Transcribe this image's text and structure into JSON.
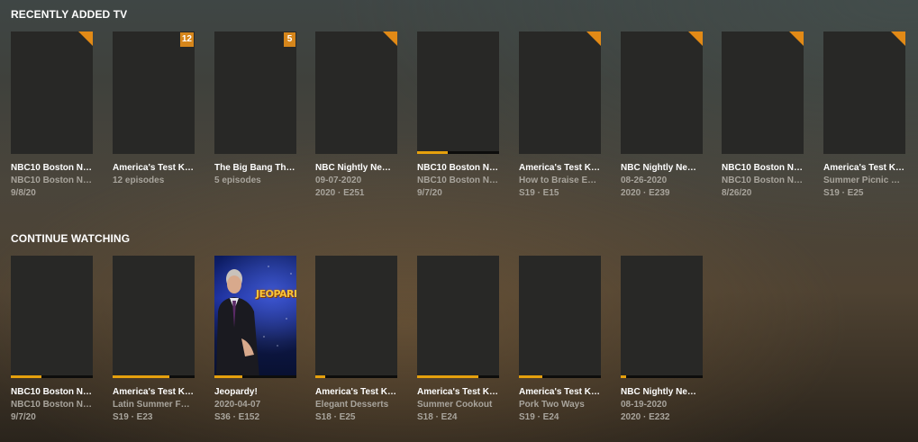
{
  "recently_added": {
    "heading": "RECENTLY ADDED TV",
    "items": [
      {
        "title": "NBC10 Boston Ne...",
        "sub": "NBC10 Boston Ne...",
        "sub2": "9/8/20",
        "marker": "corner",
        "badge": "",
        "progress": 0
      },
      {
        "title": "America's Test Kit...",
        "sub": "12 episodes",
        "sub2": "",
        "marker": "badge",
        "badge": "12",
        "progress": 0
      },
      {
        "title": "The Big Bang The...",
        "sub": "5 episodes",
        "sub2": "",
        "marker": "badge",
        "badge": "5",
        "progress": 0
      },
      {
        "title": "NBC Nightly News...",
        "sub": "09-07-2020",
        "sub2": "2020 · E251",
        "marker": "corner",
        "badge": "",
        "progress": 0
      },
      {
        "title": "NBC10 Boston Ne...",
        "sub": "NBC10 Boston Ne...",
        "sub2": "9/7/20",
        "marker": "none",
        "badge": "",
        "progress": 0.37
      },
      {
        "title": "America's Test Kit...",
        "sub": "How to Braise Eve...",
        "sub2": "S19 · E15",
        "marker": "corner",
        "badge": "",
        "progress": 0
      },
      {
        "title": "NBC Nightly News...",
        "sub": "08-26-2020",
        "sub2": "2020 · E239",
        "marker": "corner",
        "badge": "",
        "progress": 0
      },
      {
        "title": "NBC10 Boston Ne...",
        "sub": "NBC10 Boston Ne...",
        "sub2": "8/26/20",
        "marker": "corner",
        "badge": "",
        "progress": 0
      },
      {
        "title": "America's Test Kit...",
        "sub": "Summer Picnic Pa...",
        "sub2": "S19 · E25",
        "marker": "corner",
        "badge": "",
        "progress": 0
      }
    ]
  },
  "continue_watching": {
    "heading": "CONTINUE WATCHING",
    "items": [
      {
        "title": "NBC10 Boston Ne...",
        "sub": "NBC10 Boston Ne...",
        "sub2": "9/7/20",
        "progress": 0.37,
        "art": ""
      },
      {
        "title": "America's Test Kit...",
        "sub": "Latin Summer Fav...",
        "sub2": "S19 · E23",
        "progress": 0.69,
        "art": ""
      },
      {
        "title": "Jeopardy!",
        "sub": "2020-04-07",
        "sub2": "S36 · E152",
        "progress": 0.34,
        "art": "jeopardy"
      },
      {
        "title": "America's Test Kit...",
        "sub": "Elegant Desserts",
        "sub2": "S18 · E25",
        "progress": 0.12,
        "art": ""
      },
      {
        "title": "America's Test Kit...",
        "sub": "Summer Cookout",
        "sub2": "S18 · E24",
        "progress": 0.75,
        "art": ""
      },
      {
        "title": "America's Test Kit...",
        "sub": "Pork Two Ways",
        "sub2": "S19 · E24",
        "progress": 0.29,
        "art": ""
      },
      {
        "title": "NBC Nightly News...",
        "sub": "08-19-2020",
        "sub2": "2020 · E232",
        "progress": 0.07,
        "art": ""
      }
    ]
  },
  "jeopardy_logo_text": "JEOPARDY!",
  "colors": {
    "accent": "#e5a00d",
    "corner": "#e28a16",
    "badge": "#d6861b",
    "poster_placeholder": "#282826",
    "subtext": "#a8a49c"
  }
}
